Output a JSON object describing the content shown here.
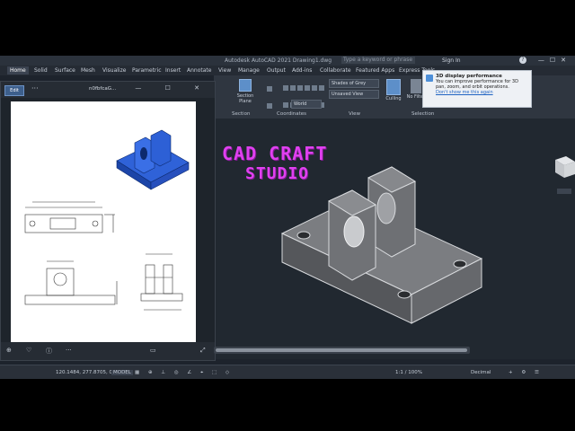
{
  "app": {
    "title": "Autodesk AutoCAD 2021   Drawing1.dwg",
    "search_placeholder": "Type a keyword or phrase",
    "sign_in": "Sign In",
    "help": "?"
  },
  "ribbon_tabs": [
    "Home",
    "Solid",
    "Surface",
    "Mesh",
    "Visualize",
    "Parametric",
    "Insert",
    "Annotate",
    "View",
    "Manage",
    "Output",
    "Add-ins",
    "Collaborate",
    "Featured Apps",
    "Express Tools"
  ],
  "ribbon": {
    "section_plane": "Section Plane",
    "panel_section": "Section",
    "panel_coordinates": "Coordinates",
    "panel_view": "View",
    "panel_selection": "Selection",
    "visual_style": "Shades of Grey",
    "view_name": "Unsaved View",
    "ucs": "World",
    "culling": "Culling",
    "no_filter": "No Filter"
  },
  "tooltip": {
    "title": "3D display performance",
    "body": "You can improve performance for 3D pan, zoom, and orbit operations.",
    "link": "Don't show me this again"
  },
  "viewer": {
    "edit": "Edit",
    "dots": "···",
    "filename": "n0fbfcaG...",
    "controls": "—   ☐   ✕"
  },
  "brand": {
    "line1": "CAD CRAFT",
    "line2": "STUDIO"
  },
  "status": {
    "coords": "120.1484, 277.8705, 0.0000",
    "model": "MODEL",
    "scale": "1:1 / 100%",
    "units": "Decimal"
  },
  "colors": {
    "accent": "#e040f0",
    "part_blue": "#2f62d8",
    "part_grey": "#6d6f73"
  }
}
